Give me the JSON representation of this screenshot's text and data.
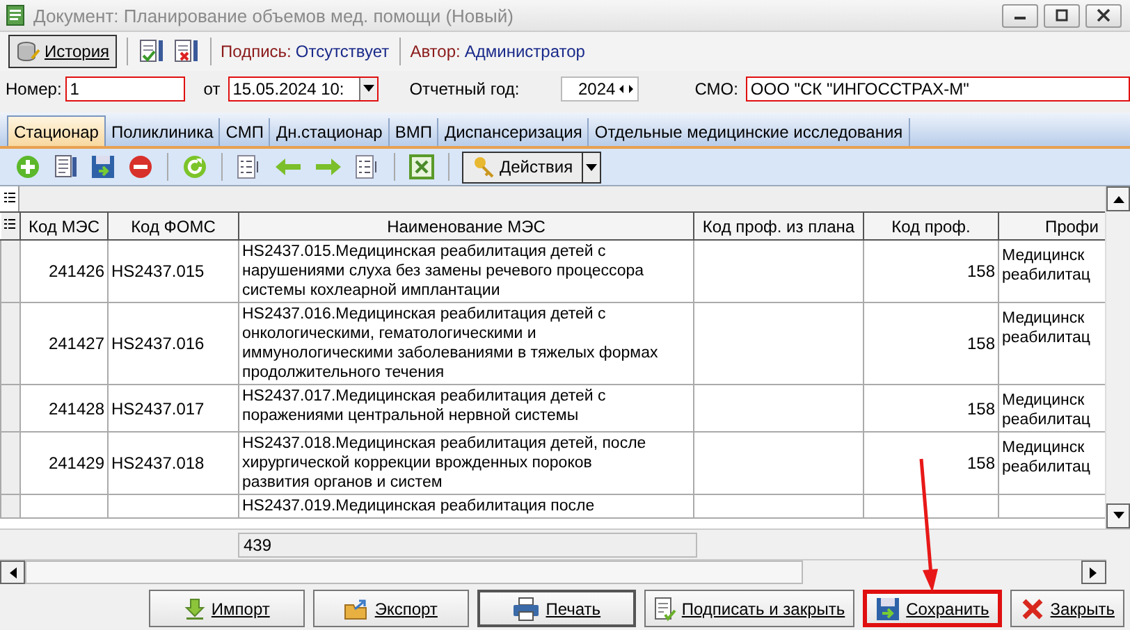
{
  "window": {
    "title": "Документ: Планирование объемов мед. помощи (Новый)"
  },
  "toolbar": {
    "history_button": "История",
    "signature_label": "Подпись:",
    "signature_value": "Отсутствует",
    "author_label": "Автор:",
    "author_value": "Администратор"
  },
  "form": {
    "number_label": "Номер:",
    "number_value": "1",
    "from_label": "от",
    "date_value": "15.05.2024 10:",
    "year_label": "Отчетный год:",
    "year_value": "2024",
    "smo_label": "СМО:",
    "smo_value": "ООО \"СК \"ИНГОССТРАХ-М\""
  },
  "tabs": [
    {
      "label": "Стационар",
      "selected": true
    },
    {
      "label": "Поликлиника",
      "selected": false
    },
    {
      "label": "СМП",
      "selected": false
    },
    {
      "label": "Дн.стационар",
      "selected": false
    },
    {
      "label": "ВМП",
      "selected": false
    },
    {
      "label": "Диспансеризация",
      "selected": false
    },
    {
      "label": "Отдельные медицинские исследования",
      "selected": false
    }
  ],
  "actions_button": "Действия",
  "table": {
    "columns": [
      "Код МЭС",
      "Код ФОМС",
      "Наименование МЭС",
      "Код проф. из плана",
      "Код проф.",
      "Профи"
    ],
    "rows": [
      {
        "kod_mes": "241426",
        "kod_foms": "HS2437.015",
        "name": "HS2437.015.Медицинская реабилитация детей с\nнарушениями слуха без замены речевого процессора\nсистемы кохлеарной имплантации",
        "kod_prof": "158",
        "profile": "Медицинск\nреабилитац"
      },
      {
        "kod_mes": "241427",
        "kod_foms": "HS2437.016",
        "name": "HS2437.016.Медицинская реабилитация детей с\nонкологическими, гематологическими и\nиммунологическими заболеваниями в тяжелых формах\nпродолжительного течения",
        "kod_prof": "158",
        "profile": "Медицинск\nреабилитац"
      },
      {
        "kod_mes": "241428",
        "kod_foms": "HS2437.017",
        "name": "HS2437.017.Медицинская реабилитация детей с\nпоражениями центральной нервной системы",
        "kod_prof": "158",
        "profile": "Медицинск\nреабилитац"
      },
      {
        "kod_mes": "241429",
        "kod_foms": "HS2437.018",
        "name": "HS2437.018.Медицинская реабилитация детей, после\nхирургической коррекции врожденных пороков\nразвития органов и систем",
        "kod_prof": "158",
        "profile": "Медицинск\nреабилитац"
      },
      {
        "name": "HS2437.019.Медицинская реабилитация после"
      }
    ],
    "footer_value": "439"
  },
  "buttons": [
    {
      "kind": "import",
      "label": "Импорт",
      "highlighted": false
    },
    {
      "kind": "export",
      "label": "Экспорт",
      "highlighted": false
    },
    {
      "kind": "print",
      "label": "Печать",
      "highlighted": false
    },
    {
      "kind": "sign",
      "label": "Подписать и закрыть",
      "highlighted": false
    },
    {
      "kind": "save",
      "label": "Сохранить",
      "highlighted": true
    },
    {
      "kind": "close",
      "label": "Закрыть",
      "highlighted": false
    }
  ]
}
